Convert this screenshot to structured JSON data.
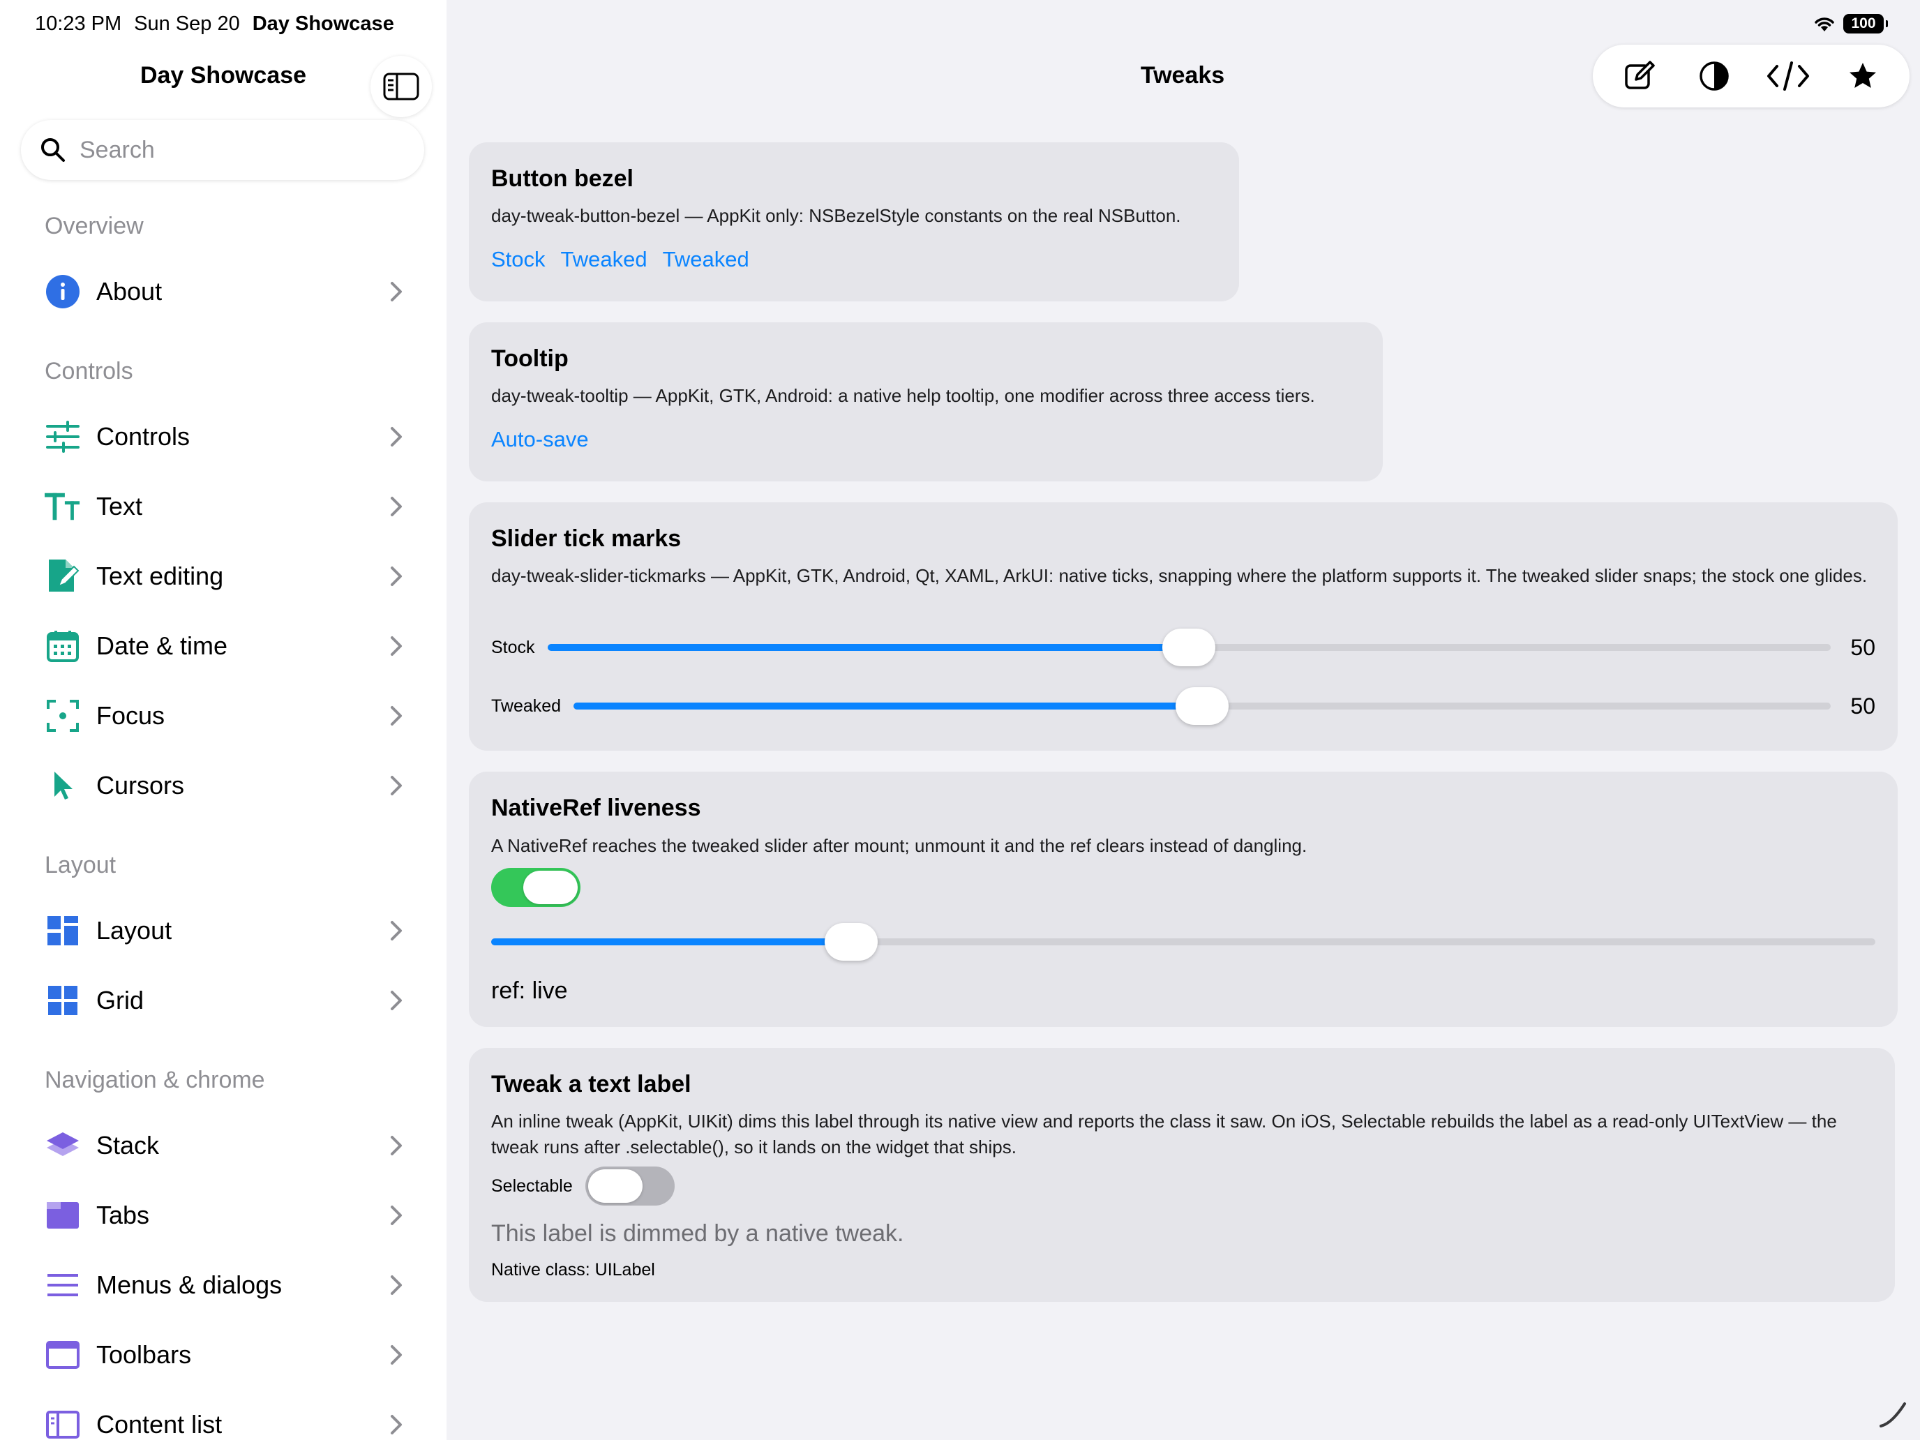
{
  "status_bar": {
    "time": "10:23 PM",
    "date": "Sun Sep 20",
    "app": "Day Showcase",
    "battery": "100"
  },
  "sidebar": {
    "title": "Day Showcase",
    "search_placeholder": "Search",
    "sections": {
      "overview": "Overview",
      "controls": "Controls",
      "layout": "Layout",
      "navigation": "Navigation & chrome"
    },
    "items": [
      {
        "label": "About",
        "icon": "info-icon"
      },
      {
        "label": "Controls",
        "icon": "sliders-icon"
      },
      {
        "label": "Text",
        "icon": "text-size-icon"
      },
      {
        "label": "Text editing",
        "icon": "document-edit-icon"
      },
      {
        "label": "Date & time",
        "icon": "calendar-icon"
      },
      {
        "label": "Focus",
        "icon": "focus-icon"
      },
      {
        "label": "Cursors",
        "icon": "cursor-icon"
      },
      {
        "label": "Layout",
        "icon": "layout-grid-icon"
      },
      {
        "label": "Grid",
        "icon": "grid-icon"
      },
      {
        "label": "Stack",
        "icon": "stack-icon"
      },
      {
        "label": "Tabs",
        "icon": "tabs-icon"
      },
      {
        "label": "Menus & dialogs",
        "icon": "menu-lines-icon"
      },
      {
        "label": "Toolbars",
        "icon": "window-icon"
      },
      {
        "label": "Content list",
        "icon": "sidebar-list-icon"
      }
    ],
    "colors": {
      "teal": "#17a589",
      "blue": "#2f6fe4",
      "purple": "#7b5fe0"
    }
  },
  "main": {
    "title": "Tweaks",
    "toolbar": [
      "compose-icon",
      "contrast-icon",
      "code-icon",
      "star-icon"
    ],
    "cards": {
      "bezel": {
        "title": "Button bezel",
        "desc": "day-tweak-button-bezel — AppKit only: NSBezelStyle constants on the real NSButton.",
        "links": [
          "Stock",
          "Tweaked",
          "Tweaked"
        ]
      },
      "tooltip": {
        "title": "Tooltip",
        "desc": "day-tweak-tooltip — AppKit, GTK, Android: a native help tooltip, one modifier across three access tiers.",
        "link": "Auto-save"
      },
      "slider": {
        "title": "Slider tick marks",
        "desc": "day-tweak-slider-tickmarks — AppKit, GTK, Android, Qt, XAML, ArkUI: native ticks, snapping where the platform supports it. The tweaked slider snaps; the stock one glides.",
        "stock_label": "Stock",
        "stock_value": "50",
        "stock_fraction": 0.5,
        "tweaked_label": "Tweaked",
        "tweaked_value": "50",
        "tweaked_fraction": 0.5
      },
      "nativeref": {
        "title": "NativeRef liveness",
        "desc": "A NativeRef reaches the tweaked slider after mount; unmount it and the ref clears instead of dangling.",
        "toggle_on": true,
        "slider_fraction": 0.26,
        "ref_text": "ref: live"
      },
      "textlabel": {
        "title": "Tweak a text label",
        "desc": "An inline tweak (AppKit, UIKit) dims this label through its native view and reports the class it saw. On iOS, Selectable rebuilds the label as a read-only UITextView — the tweak runs after .selectable(), so it lands on the widget that ships.",
        "selectable_label": "Selectable",
        "selectable_on": false,
        "dimmed_text": "This label is dimmed by a native tweak.",
        "native_class": "Native class: UILabel"
      }
    }
  }
}
